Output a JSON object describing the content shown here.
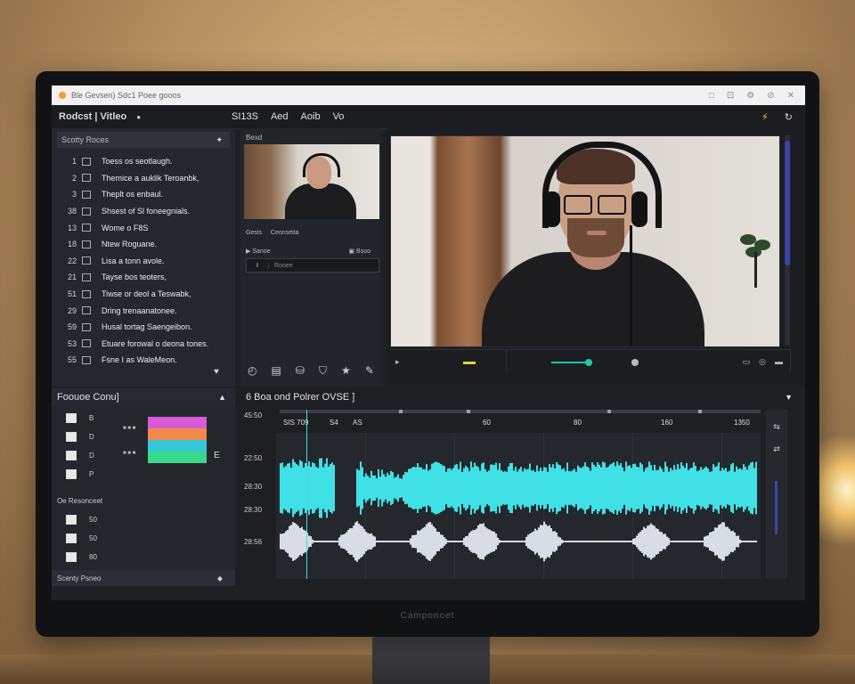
{
  "window": {
    "title": "Ble Gevsen) Sdc1 Poee gooos",
    "win_buttons": [
      "□",
      "⊡",
      "⚙",
      "⊘",
      "✕"
    ]
  },
  "header": {
    "app_title": "Rodcst | Vitleo",
    "menu": [
      "SI13S",
      "Aed",
      "Aoib",
      "Vo"
    ],
    "right_icons": [
      "bolt-icon",
      "refresh-icon"
    ]
  },
  "steps_panel": {
    "title": "Scotty Roces",
    "items": [
      {
        "num": "1",
        "label": "Toess os seotlaugh."
      },
      {
        "num": "2",
        "label": "Themice a auklik Teroanbk,"
      },
      {
        "num": "3",
        "label": "Theplt os enbaul."
      },
      {
        "num": "38",
        "label": "Shsest of Sl foneegnials."
      },
      {
        "num": "13",
        "label": "Wome o F8S"
      },
      {
        "num": "18",
        "label": "Ntew Roguane."
      },
      {
        "num": "22",
        "label": "Lisa a tonn avole."
      },
      {
        "num": "21",
        "label": "Tayse bos teoters,"
      },
      {
        "num": "51",
        "label": "Tiwse or deol a Teswabk,"
      },
      {
        "num": "29",
        "label": "Dring trenaanatonee."
      },
      {
        "num": "59",
        "label": "Husal tortag Saengeibon."
      },
      {
        "num": "53",
        "label": "Etuare forowal o deona tones."
      },
      {
        "num": "55",
        "label": "Fsne I as WaleMeon."
      }
    ]
  },
  "mid_panel": {
    "label": "Bexd",
    "row1": [
      "Gesis",
      "Ceonseita"
    ],
    "row2_left": "▶ Sanoe",
    "row2_right": "▣ Bsoo",
    "field_cursor": "I",
    "field_value": "Rooee",
    "tools": [
      "clock-icon",
      "file-icon",
      "bucket-icon",
      "shield-icon",
      "star-icon",
      "pen-icon"
    ]
  },
  "preview": {
    "transport_icons": [
      "▭",
      "◎",
      "▬"
    ]
  },
  "props_panel": {
    "title": "Foouoe Conu]",
    "rows": [
      {
        "icon": "s",
        "label": "B"
      },
      {
        "icon": "b",
        "label": "D"
      },
      {
        "icon": "v",
        "label": "D"
      },
      {
        "icon": "a",
        "label": "P"
      }
    ],
    "swatch_labels": [
      "■ ■ ■",
      "■ ■ ■"
    ],
    "swatch_letter": "E",
    "swatches": [
      "#d95ad8",
      "#f08a4a",
      "#36c8d8",
      "#39d98a"
    ],
    "sub_title": "Oe Resonceet",
    "sub_rows": [
      "50",
      "50",
      "80"
    ],
    "footer": "Scenty Psneo"
  },
  "timeline": {
    "title": "6 Boa ond Polrer OVSE ]",
    "ruler": [
      "SIS 709",
      "S4",
      "AS",
      "60",
      "80",
      "160",
      "1350"
    ],
    "times": [
      "45:50",
      "22:50",
      "28:30",
      "28:30",
      "28:56"
    ]
  }
}
